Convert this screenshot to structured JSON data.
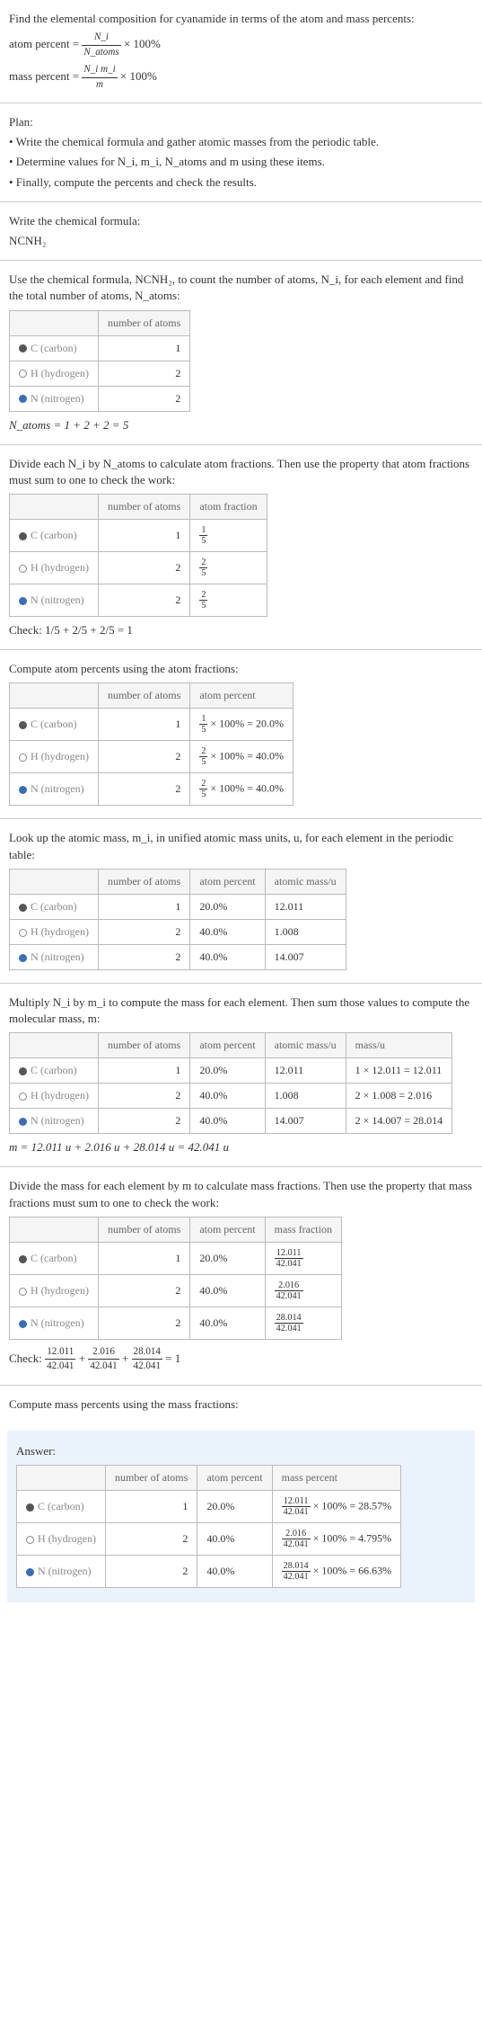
{
  "intro": {
    "line1": "Find the elemental composition for cyanamide in terms of the atom and mass percents:",
    "atom_label": "atom percent =",
    "atom_formula_num": "N_i",
    "atom_formula_den": "N_atoms",
    "mass_label": "mass percent =",
    "mass_formula_num": "N_i m_i",
    "mass_formula_den": "m",
    "times100": "× 100%"
  },
  "plan": {
    "heading": "Plan:",
    "b1": "• Write the chemical formula and gather atomic masses from the periodic table.",
    "b2": "• Determine values for N_i, m_i, N_atoms and m using these items.",
    "b3": "• Finally, compute the percents and check the results."
  },
  "formula": {
    "heading": "Write the chemical formula:",
    "value": "NCNH₂"
  },
  "count": {
    "intro": "Use the chemical formula, NCNH₂, to count the number of atoms, N_i, for each element and find the total number of atoms, N_atoms:",
    "headers": {
      "atoms": "number of atoms"
    },
    "rows": [
      {
        "el": "C (carbon)",
        "n": "1"
      },
      {
        "el": "H (hydrogen)",
        "n": "2"
      },
      {
        "el": "N (nitrogen)",
        "n": "2"
      }
    ],
    "total": "N_atoms = 1 + 2 + 2 = 5"
  },
  "atomfrac": {
    "intro": "Divide each N_i by N_atoms to calculate atom fractions. Then use the property that atom fractions must sum to one to check the work:",
    "headers": {
      "atoms": "number of atoms",
      "frac": "atom fraction"
    },
    "rows": [
      {
        "el": "C (carbon)",
        "n": "1",
        "fn": "1",
        "fd": "5"
      },
      {
        "el": "H (hydrogen)",
        "n": "2",
        "fn": "2",
        "fd": "5"
      },
      {
        "el": "N (nitrogen)",
        "n": "2",
        "fn": "2",
        "fd": "5"
      }
    ],
    "check_label": "Check: ",
    "check_expr": "1/5 + 2/5 + 2/5 = 1"
  },
  "atompct": {
    "intro": "Compute atom percents using the atom fractions:",
    "headers": {
      "atoms": "number of atoms",
      "pct": "atom percent"
    },
    "rows": [
      {
        "el": "C (carbon)",
        "n": "1",
        "fn": "1",
        "fd": "5",
        "res": "× 100% = 20.0%"
      },
      {
        "el": "H (hydrogen)",
        "n": "2",
        "fn": "2",
        "fd": "5",
        "res": "× 100% = 40.0%"
      },
      {
        "el": "N (nitrogen)",
        "n": "2",
        "fn": "2",
        "fd": "5",
        "res": "× 100% = 40.0%"
      }
    ]
  },
  "atomicmass": {
    "intro": "Look up the atomic mass, m_i, in unified atomic mass units, u, for each element in the periodic table:",
    "headers": {
      "atoms": "number of atoms",
      "pct": "atom percent",
      "mass": "atomic mass/u"
    },
    "rows": [
      {
        "el": "C (carbon)",
        "n": "1",
        "p": "20.0%",
        "m": "12.011"
      },
      {
        "el": "H (hydrogen)",
        "n": "2",
        "p": "40.0%",
        "m": "1.008"
      },
      {
        "el": "N (nitrogen)",
        "n": "2",
        "p": "40.0%",
        "m": "14.007"
      }
    ]
  },
  "massu": {
    "intro": "Multiply N_i by m_i to compute the mass for each element. Then sum those values to compute the molecular mass, m:",
    "headers": {
      "atoms": "number of atoms",
      "pct": "atom percent",
      "mass": "atomic mass/u",
      "mu": "mass/u"
    },
    "rows": [
      {
        "el": "C (carbon)",
        "n": "1",
        "p": "20.0%",
        "m": "12.011",
        "calc": "1 × 12.011 = 12.011"
      },
      {
        "el": "H (hydrogen)",
        "n": "2",
        "p": "40.0%",
        "m": "1.008",
        "calc": "2 × 1.008 = 2.016"
      },
      {
        "el": "N (nitrogen)",
        "n": "2",
        "p": "40.0%",
        "m": "14.007",
        "calc": "2 × 14.007 = 28.014"
      }
    ],
    "total": "m = 12.011 u + 2.016 u + 28.014 u = 42.041 u"
  },
  "massfrac": {
    "intro": "Divide the mass for each element by m to calculate mass fractions. Then use the property that mass fractions must sum to one to check the work:",
    "headers": {
      "atoms": "number of atoms",
      "pct": "atom percent",
      "mf": "mass fraction"
    },
    "rows": [
      {
        "el": "C (carbon)",
        "n": "1",
        "p": "20.0%",
        "fn": "12.011",
        "fd": "42.041"
      },
      {
        "el": "H (hydrogen)",
        "n": "2",
        "p": "40.0%",
        "fn": "2.016",
        "fd": "42.041"
      },
      {
        "el": "N (nitrogen)",
        "n": "2",
        "p": "40.0%",
        "fn": "28.014",
        "fd": "42.041"
      }
    ],
    "check_label": "Check: ",
    "check_parts": [
      {
        "n": "12.011",
        "d": "42.041"
      },
      {
        "n": "2.016",
        "d": "42.041"
      },
      {
        "n": "28.014",
        "d": "42.041"
      }
    ],
    "check_eq": " = 1"
  },
  "masspct": {
    "intro": "Compute mass percents using the mass fractions:",
    "answer_label": "Answer:",
    "headers": {
      "atoms": "number of atoms",
      "pct": "atom percent",
      "mp": "mass percent"
    },
    "rows": [
      {
        "el": "C (carbon)",
        "n": "1",
        "p": "20.0%",
        "fn": "12.011",
        "fd": "42.041",
        "res": "× 100% = 28.57%"
      },
      {
        "el": "H (hydrogen)",
        "n": "2",
        "p": "40.0%",
        "fn": "2.016",
        "fd": "42.041",
        "res": "× 100% = 4.795%"
      },
      {
        "el": "N (nitrogen)",
        "n": "2",
        "p": "40.0%",
        "fn": "28.014",
        "fd": "42.041",
        "res": "× 100% = 66.63%"
      }
    ]
  }
}
